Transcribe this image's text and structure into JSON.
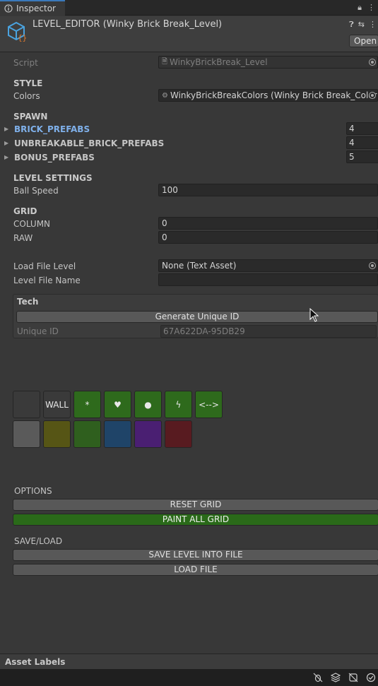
{
  "tab": {
    "label": "Inspector"
  },
  "header": {
    "title": "LEVEL_EDITOR (Winky Brick Break_Level)",
    "open_label": "Open"
  },
  "script": {
    "label": "Script",
    "value": "WinkyBrickBreak_Level"
  },
  "style": {
    "section": "STYLE",
    "colors_label": "Colors",
    "colors_value": "WinkyBrickBreakColors (Winky Brick Break_Color"
  },
  "spawn": {
    "section": "SPAWN",
    "items": [
      {
        "label": "BRICK_PREFABS",
        "count": "4"
      },
      {
        "label": "UNBREAKABLE_BRICK_PREFABS",
        "count": "4"
      },
      {
        "label": "BONUS_PREFABS",
        "count": "5"
      }
    ]
  },
  "level_settings": {
    "section": "LEVEL SETTINGS",
    "ball_speed_label": "Ball Speed",
    "ball_speed_value": "100"
  },
  "grid": {
    "section": "GRID",
    "column_label": "COLUMN",
    "column_value": "0",
    "raw_label": "RAW",
    "raw_value": "0"
  },
  "file": {
    "load_label": "Load File Level",
    "load_value": "None (Text Asset)",
    "name_label": "Level File Name",
    "name_value": ""
  },
  "tech": {
    "title": "Tech",
    "generate_label": "Generate Unique ID",
    "uid_label": "Unique ID",
    "uid_value": "67A622DA-95DB29"
  },
  "palette": {
    "tools": [
      {
        "label": "",
        "color": "#3a3a3a"
      },
      {
        "label": "WALL",
        "color": "#3a3a3a"
      },
      {
        "label": "*",
        "color": "#2e6a1c"
      },
      {
        "label": "♥",
        "color": "#2e6a1c"
      },
      {
        "label": "●",
        "color": "#2e6a1c"
      },
      {
        "label": "ϟ",
        "color": "#2e6a1c"
      },
      {
        "label": "<-->",
        "color": "#2e6a1c"
      }
    ],
    "colors": [
      "#5a5a5a",
      "#565515",
      "#2f5f1e",
      "#1f4468",
      "#4a1f72",
      "#581b20"
    ]
  },
  "options": {
    "section": "OPTIONS",
    "reset_label": "RESET GRID",
    "paint_label": "PAINT ALL GRID"
  },
  "saveload": {
    "section": "SAVE/LOAD",
    "save_label": "SAVE LEVEL INTO FILE",
    "load_label": "LOAD FILE"
  },
  "footer": {
    "asset_labels": "Asset Labels"
  }
}
